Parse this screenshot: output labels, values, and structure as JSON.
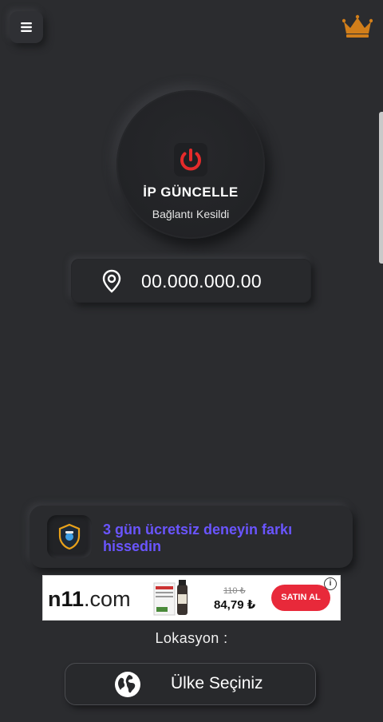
{
  "header": {
    "menu_icon": "hamburger-menu-icon",
    "premium_icon": "crown-icon",
    "premium_color": "#d17e1a"
  },
  "power": {
    "title": "İP GÜNCELLE",
    "status": "Bağlantı Kesildi",
    "icon": "power-icon",
    "icon_color": "#e52b2b"
  },
  "ip": {
    "icon": "location-pin-icon",
    "value": "00.000.000.00"
  },
  "promo": {
    "icon": "vpn-shield-icon",
    "text": "3 gün ücretsiz deneyin farkı hissedin",
    "text_color": "#6a55ff"
  },
  "ad": {
    "brand_prefix": "n",
    "brand_highlight": "11",
    "brand_suffix": ".com",
    "old_price": "110 ₺",
    "new_price": "84,79 ₺",
    "buy_label": "SATIN AL",
    "info_label": "i",
    "buy_color": "#e8293a"
  },
  "location": {
    "label": "Lokasyon :",
    "button_label": "Ülke Seçiniz",
    "button_icon": "globe-icon"
  }
}
